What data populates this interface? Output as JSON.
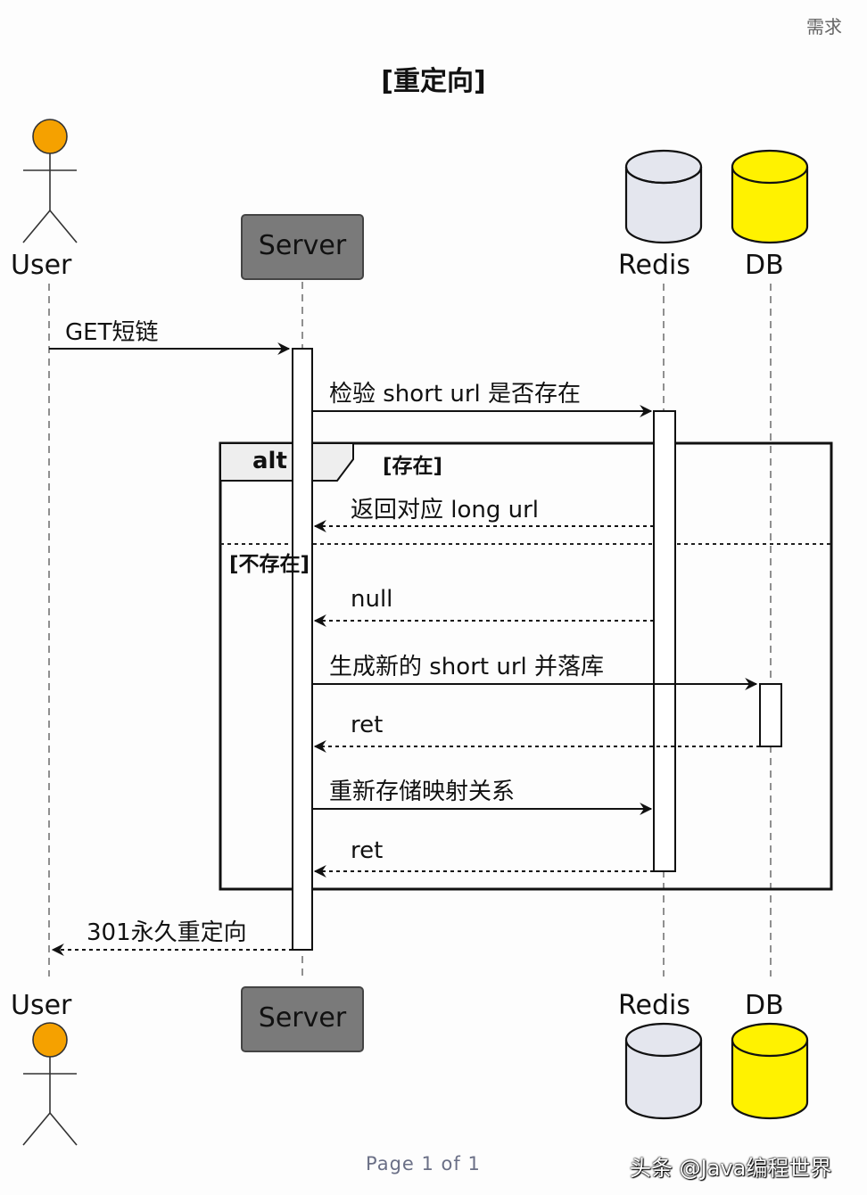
{
  "header_tag": "需求",
  "title": "[重定向]",
  "participants": {
    "user": "User",
    "server": "Server",
    "redis": "Redis",
    "db": "DB"
  },
  "colors": {
    "user_head": "#F5A100",
    "server_box": "#7A7A7A",
    "redis_cylinder": "#E4E6EE",
    "db_cylinder": "#FFF200"
  },
  "messages": {
    "m1": "GET短链",
    "m2": "检验 short url 是否存在",
    "m3": "返回对应 long url",
    "m4": "null",
    "m5": "生成新的 short url 并落库",
    "m6": "ret",
    "m7": "重新存储映射关系",
    "m8": "ret",
    "m9": "301永久重定向"
  },
  "alt": {
    "keyword": "alt",
    "guard_1": "[存在]",
    "guard_2": "[不存在]"
  },
  "footer": {
    "page": "Page 1 of 1",
    "watermark": "头条 @Java编程世界"
  }
}
